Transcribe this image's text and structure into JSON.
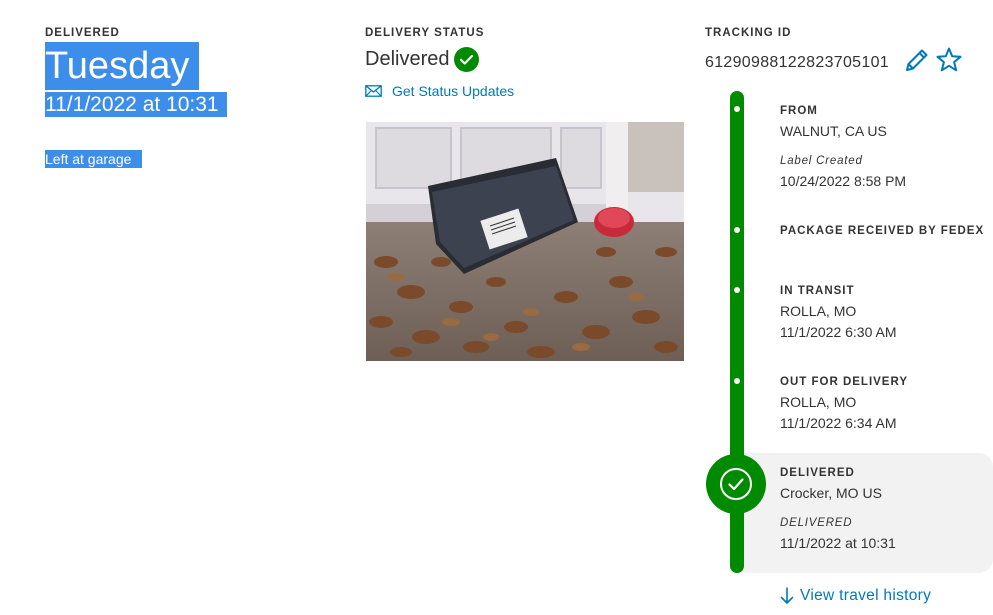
{
  "delivered": {
    "label": "DELIVERED",
    "day": "Tuesday",
    "datetime": "11/1/2022 at 10:31",
    "note": "Left at garage"
  },
  "status": {
    "label": "DELIVERY STATUS",
    "value": "Delivered",
    "updates_link": "Get Status Updates",
    "check_icon": "check-circle-icon",
    "mail_icon": "envelope-icon"
  },
  "tracking": {
    "label": "TRACKING ID",
    "id": "612909881228237051​01",
    "edit_icon": "pencil-icon",
    "star_icon": "star-outline-icon"
  },
  "events": [
    {
      "title": "FROM",
      "line1": "WALNUT, CA US",
      "italic": "Label Created",
      "line2": "10/24/2022 8:58 PM"
    },
    {
      "title": "PACKAGE RECEIVED BY FEDEX"
    },
    {
      "title": "IN TRANSIT",
      "line1": "ROLLA, MO",
      "line2": "11/1/2022 6:30 AM"
    },
    {
      "title": "OUT FOR DELIVERY",
      "line1": "ROLLA, MO",
      "line2": "11/1/2022 6:34 AM"
    },
    {
      "title": "DELIVERED",
      "line1": "Crocker, MO US",
      "italic": "DELIVERED",
      "line2": "11/1/2022 at 10:31"
    }
  ],
  "history_link": "View travel history",
  "colors": {
    "green": "#008a00",
    "link_blue": "#007ab7",
    "selection_blue": "#3d8eea",
    "text": "#333333"
  }
}
